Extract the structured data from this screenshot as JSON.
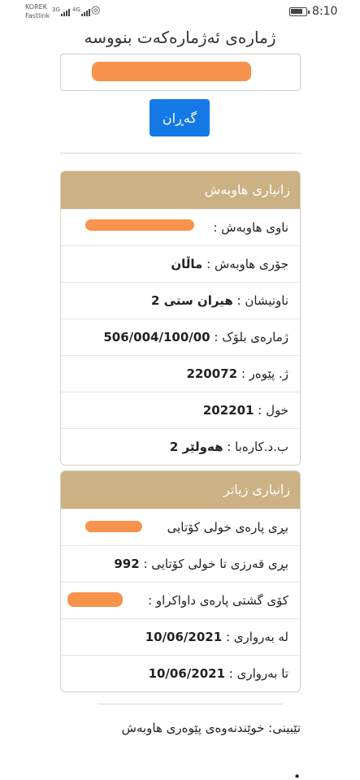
{
  "status_bar": {
    "carrier_line1": "KOREK",
    "carrier_line2": "Fastlink",
    "sig1": "3G",
    "sig2": "4G",
    "time": "8:10",
    "battery_level": 0.85
  },
  "search": {
    "heading": "ژمارەی ئەژمارەکەت بنووسە",
    "button_label": "گەڕان"
  },
  "subscriber": {
    "title": "زانیاری هاوبەش",
    "name_label": "ناوی هاوبەش :",
    "type_label": "جۆری هاوبەش :",
    "type_value": "ماڵان",
    "address_label": "ناونیشان :",
    "address_value": "هیران ستی 2",
    "block_label": "ژمارەی بلۆک :",
    "block_value": "506/004/100/00",
    "meter_label": "ژ. پێوەر :",
    "meter_value": "220072",
    "cycle_label": "خول :",
    "cycle_value": "202201",
    "directorate_label": "ب.د.کارەبا :",
    "directorate_value": "هەولێر 2"
  },
  "details": {
    "title": "زانیاری زیاتر",
    "last_payment_label": "بڕی پارەی خولی کۆتایی",
    "debt_label": "بڕی قەرزی تا خولی کۆتایی :",
    "debt_value": "992",
    "total_label": "کۆی گشتی پارەی داواکراو :",
    "from_label": "لە بەرواری :",
    "from_value": "10/06/2021",
    "to_label": "تا بەرواری :",
    "to_value": "10/06/2021"
  },
  "note": {
    "text": "تێبینی: خوێندنەوەی پێوەری هاوبەش"
  },
  "colors": {
    "header_bg": "#cbb183",
    "button_bg": "#1479e6",
    "redaction": "#f7934c"
  }
}
